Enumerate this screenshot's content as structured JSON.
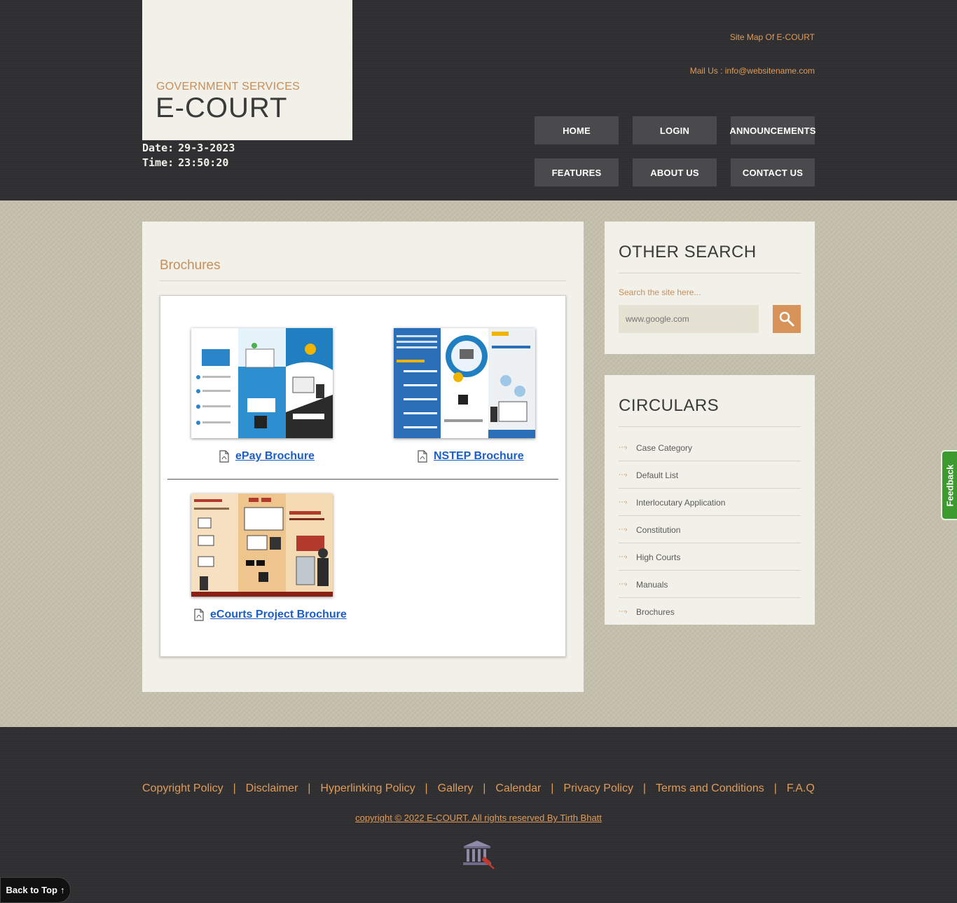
{
  "header": {
    "logo_subtitle": "GOVERNMENT SERVICES",
    "logo_title": "E-COURT",
    "date_label": "Date:",
    "date_value": "29-3-2023",
    "time_label": "Time:",
    "time_value": "23:50:20",
    "sitemap_label": "Site Map Of E-COURT",
    "mail_label": "Mail Us :",
    "mail_value": "info@websitename.com",
    "nav": [
      "HOME",
      "LOGIN",
      "ANNOUNCEMENTS",
      "FEATURES",
      "ABOUT US",
      "CONTACT US"
    ]
  },
  "content": {
    "title": "Brochures",
    "brochures": [
      {
        "label": "ePay Brochure",
        "icon": "pdf-icon"
      },
      {
        "label": "NSTEP Brochure",
        "icon": "pdf-icon"
      },
      {
        "label": "eCourts Project Brochure",
        "icon": "pdf-icon"
      }
    ]
  },
  "sidebar": {
    "search_title": "OTHER SEARCH",
    "search_label": "Search the site here...",
    "search_placeholder": "www.google.com",
    "search_icon": "magnifier-icon",
    "circulars_title": "CIRCULARS",
    "circulars": [
      "Case Category",
      "Default List",
      "Interlocutary Application",
      "Constitution",
      "High Courts",
      "Manuals",
      "Brochures"
    ]
  },
  "feedback_label": "Feedback",
  "footer": {
    "links": [
      "Copyright Policy",
      "Disclaimer",
      "Hyperlinking Policy",
      "Gallery",
      "Calendar",
      "Privacy Policy",
      "Terms and Conditions",
      "F.A.Q"
    ],
    "separator": "|",
    "copyright": "copyright © 2022 E-COURT. All rights reserved By Tirth Bhatt",
    "back_to_top": "Back to Top",
    "back_to_top_arrow": "↑"
  },
  "colors": {
    "accent": "#c98e58",
    "link": "#1a5ec7",
    "header_bg": "#2f2f31",
    "main_bg": "#c4c0ac",
    "panel_bg": "#f1f0e9"
  }
}
